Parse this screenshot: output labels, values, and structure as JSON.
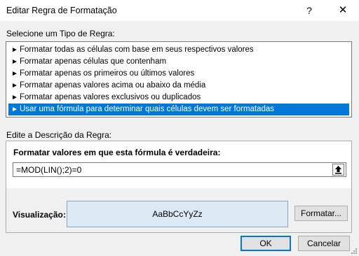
{
  "dialog": {
    "title": "Editar Regra de Formatação",
    "help_glyph": "?",
    "close_glyph": "✕"
  },
  "rule_type": {
    "label": "Selecione um Tipo de Regra:",
    "items": [
      {
        "label": "Formatar todas as células com base em seus respectivos valores",
        "selected": false
      },
      {
        "label": "Formatar apenas células que contenham",
        "selected": false
      },
      {
        "label": "Formatar apenas os primeiros ou últimos valores",
        "selected": false
      },
      {
        "label": "Formatar apenas valores acima ou abaixo da média",
        "selected": false
      },
      {
        "label": "Formatar apenas valores exclusivos ou duplicados",
        "selected": false
      },
      {
        "label": "Usar uma fórmula para determinar quais células devem ser formatadas",
        "selected": true
      }
    ],
    "item_arrow": "►"
  },
  "description": {
    "label": "Edite a Descrição da Regra:",
    "formula_label": "Formatar valores em que esta fórmula é verdadeira:",
    "formula_value": "=MOD(LIN();2)=0",
    "preview_label": "Visualização:",
    "preview_text": "AaBbCcYyZz",
    "format_button": "Formatar..."
  },
  "buttons": {
    "ok": "OK",
    "cancel": "Cancelar"
  },
  "colors": {
    "selection": "#0078d7",
    "preview_fill": "#dbe9f4"
  },
  "icons": {
    "collapse": "collapse-dialog-icon",
    "resize": "resize-grip-icon"
  }
}
